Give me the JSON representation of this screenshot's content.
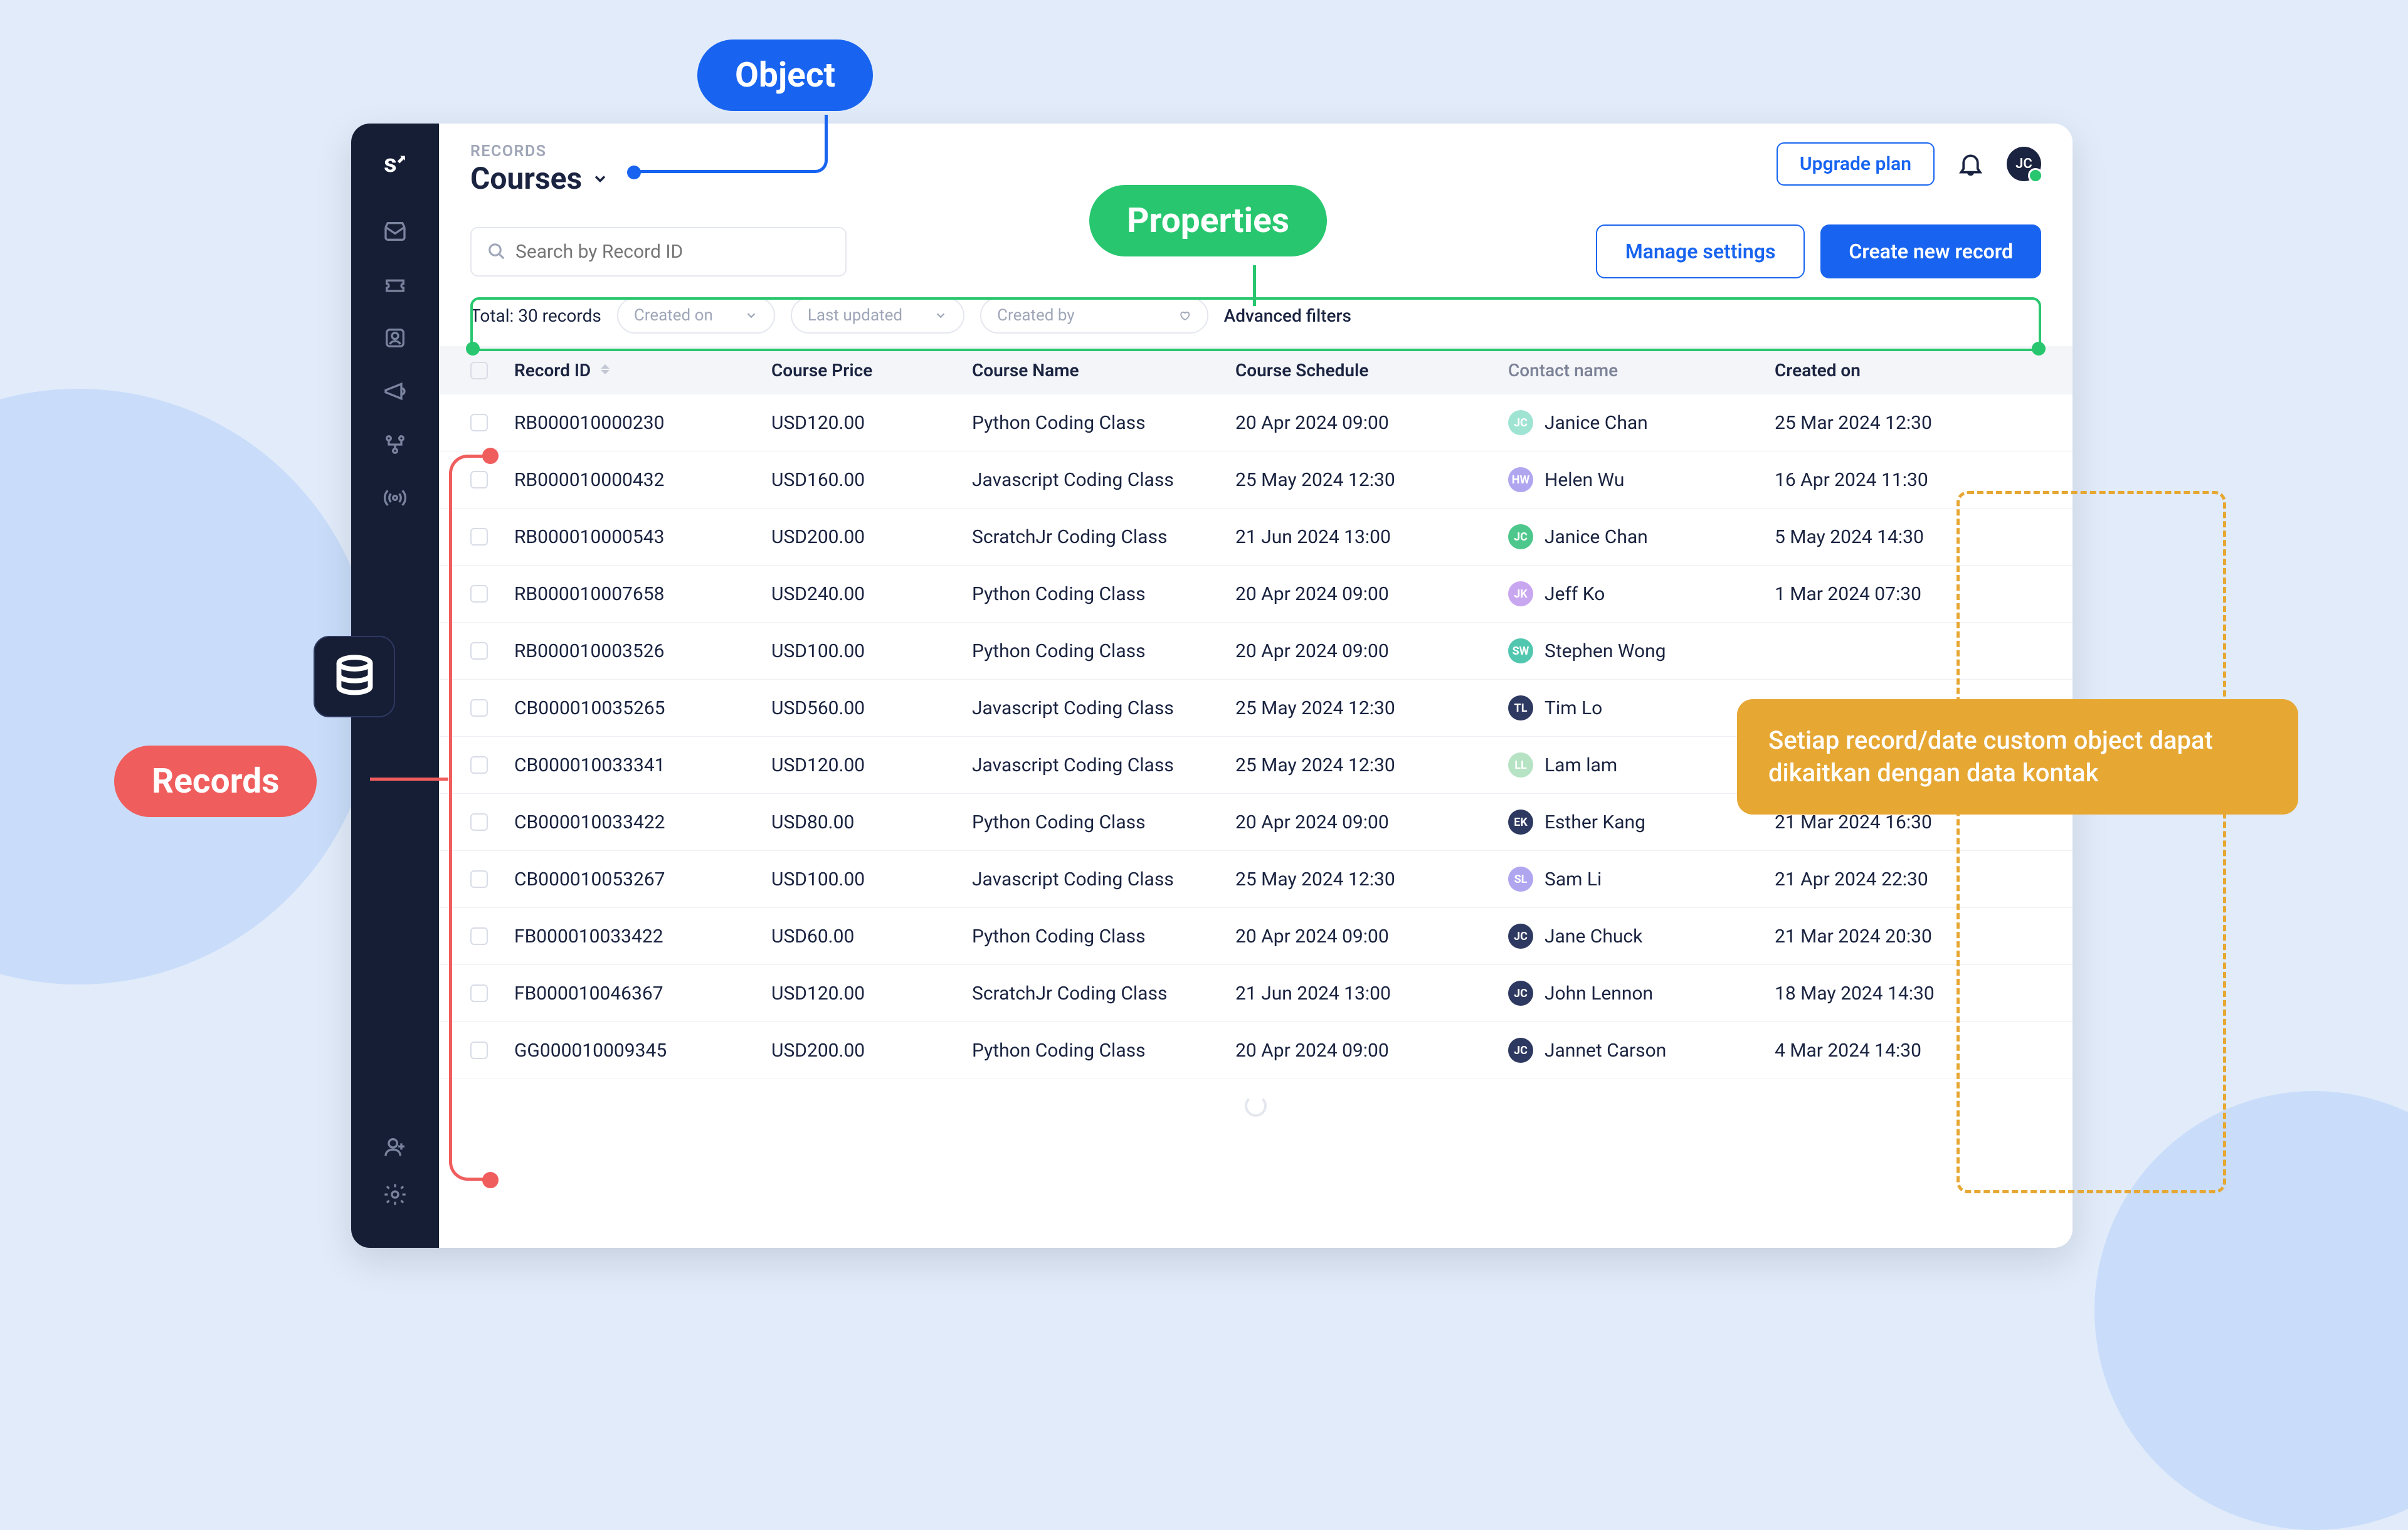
{
  "annotations": {
    "object": "Object",
    "properties": "Properties",
    "records": "Records",
    "tooltip": "Setiap record/date custom object dapat dikaitkan dengan data kontak"
  },
  "header": {
    "breadcrumb": "RECORDS",
    "title": "Courses",
    "upgrade": "Upgrade plan",
    "avatar": "JC"
  },
  "toolbar": {
    "search_placeholder": "Search by Record ID",
    "settings": "Manage settings",
    "create": "Create new record"
  },
  "filters": {
    "total": "Total: 30 records",
    "f1": "Created on",
    "f2": "Last updated",
    "f3": "Created by",
    "adv": "Advanced filters"
  },
  "columns": {
    "id": "Record ID",
    "price": "Course Price",
    "name": "Course Name",
    "sched": "Course Schedule",
    "contact": "Contact name",
    "created": "Created on"
  },
  "rows": [
    {
      "id": "RB000010000230",
      "price": "USD120.00",
      "name": "Python Coding Class",
      "sched": "20 Apr 2024 09:00",
      "ci": "JC",
      "cc": "#9fe3d3",
      "cn": "Janice Chan",
      "created": "25 Mar 2024 12:30"
    },
    {
      "id": "RB000010000432",
      "price": "USD160.00",
      "name": "Javascript Coding Class",
      "sched": "25 May 2024 12:30",
      "ci": "HW",
      "cc": "#b0a6f0",
      "cn": "Helen Wu",
      "created": "16 Apr 2024 11:30"
    },
    {
      "id": "RB000010000543",
      "price": "USD200.00",
      "name": "ScratchJr Coding Class",
      "sched": "21 Jun 2024 13:00",
      "ci": "JC",
      "cc": "#4dc78b",
      "cn": "Janice Chan",
      "created": "5 May 2024 14:30"
    },
    {
      "id": "RB000010007658",
      "price": "USD240.00",
      "name": "Python Coding Class",
      "sched": "20 Apr 2024 09:00",
      "ci": "JK",
      "cc": "#c9a6f0",
      "cn": "Jeff Ko",
      "created": "1 Mar 2024 07:30"
    },
    {
      "id": "RB000010003526",
      "price": "USD100.00",
      "name": "Python Coding Class",
      "sched": "20 Apr 2024 09:00",
      "ci": "SW",
      "cc": "#52c7b0",
      "cn": "Stephen Wong",
      "created": ""
    },
    {
      "id": "CB000010035265",
      "price": "USD560.00",
      "name": "Javascript Coding Class",
      "sched": "25 May 2024 12:30",
      "ci": "TL",
      "cc": "#2d3960",
      "cn": "Tim Lo",
      "created": ""
    },
    {
      "id": "CB000010033341",
      "price": "USD120.00",
      "name": "Javascript Coding Class",
      "sched": "25 May 2024 12:30",
      "ci": "LL",
      "cc": "#b6e3c4",
      "cn": "Lam lam",
      "created": ""
    },
    {
      "id": "CB000010033422",
      "price": "USD80.00",
      "name": "Python Coding Class",
      "sched": "20 Apr 2024 09:00",
      "ci": "EK",
      "cc": "#2d3960",
      "cn": "Esther Kang",
      "created": "21 Mar 2024 16:30"
    },
    {
      "id": "CB000010053267",
      "price": "USD100.00",
      "name": "Javascript Coding Class",
      "sched": "25 May 2024 12:30",
      "ci": "SL",
      "cc": "#b0a6f0",
      "cn": "Sam Li",
      "created": "21 Apr 2024 22:30"
    },
    {
      "id": "FB000010033422",
      "price": "USD60.00",
      "name": "Python Coding Class",
      "sched": "20 Apr 2024 09:00",
      "ci": "JC",
      "cc": "#2d3960",
      "cn": "Jane Chuck",
      "created": "21 Mar 2024 20:30"
    },
    {
      "id": "FB000010046367",
      "price": "USD120.00",
      "name": "ScratchJr Coding Class",
      "sched": "21 Jun 2024 13:00",
      "ci": "JC",
      "cc": "#2d3960",
      "cn": "John Lennon",
      "created": "18 May 2024 14:30"
    },
    {
      "id": "GG000010009345",
      "price": "USD200.00",
      "name": "Python Coding Class",
      "sched": "20 Apr 2024 09:00",
      "ci": "JC",
      "cc": "#2d3960",
      "cn": "Jannet Carson",
      "created": "4 Mar 2024 14:30"
    }
  ]
}
